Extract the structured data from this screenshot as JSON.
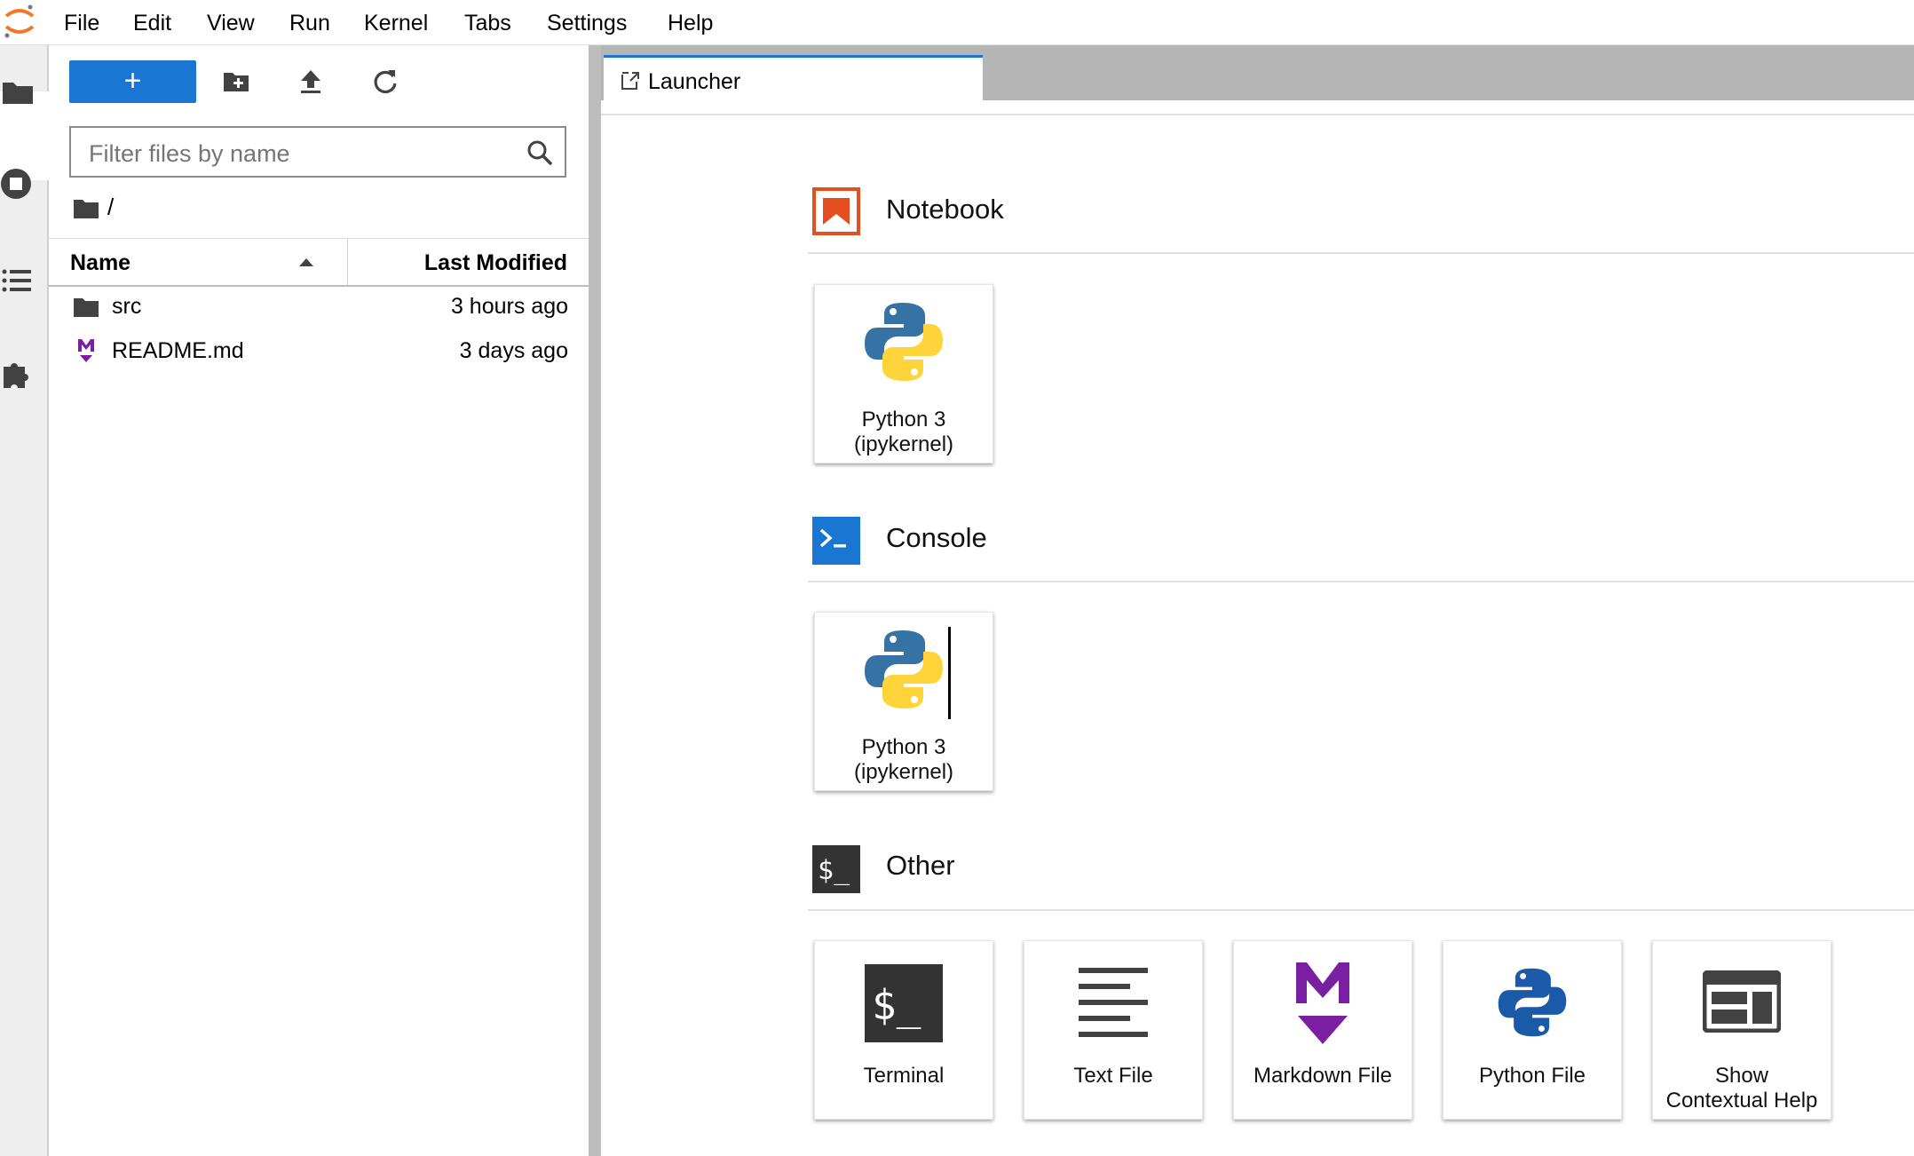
{
  "menu": {
    "items": [
      "File",
      "Edit",
      "View",
      "Run",
      "Kernel",
      "Tabs",
      "Settings",
      "Help"
    ]
  },
  "activity_bar": {
    "icons": [
      "folder-icon",
      "stop-circle-icon",
      "list-icon",
      "puzzle-icon"
    ]
  },
  "file_browser": {
    "new_label": "+",
    "toolbar_icons": [
      "new-folder-icon",
      "upload-icon",
      "refresh-icon"
    ],
    "filter_placeholder": "Filter files by name",
    "breadcrumb": "/",
    "columns": {
      "name": "Name",
      "modified": "Last Modified"
    },
    "files": [
      {
        "name": "src",
        "modified": "3 hours ago",
        "icon": "folder-icon"
      },
      {
        "name": "README.md",
        "modified": "3 days ago",
        "icon": "markdown-icon"
      }
    ]
  },
  "tabs": [
    {
      "label": "Launcher",
      "icon": "launcher-icon"
    }
  ],
  "launcher": {
    "sections": [
      {
        "title": "Notebook",
        "icon": "notebook-icon",
        "color": "#e34f1f",
        "cards": [
          {
            "line1": "Python 3",
            "line2": "(ipykernel)"
          }
        ]
      },
      {
        "title": "Console",
        "icon": "console-icon",
        "color": "#1976d2",
        "cards": [
          {
            "line1": "Python 3",
            "line2": "(ipykernel)"
          }
        ]
      },
      {
        "title": "Other",
        "icon": "terminal-icon",
        "color": "#333333",
        "cards": [
          {
            "line1": "Terminal"
          },
          {
            "line1": "Text File"
          },
          {
            "line1": "Markdown File"
          },
          {
            "line1": "Python File"
          },
          {
            "line1": "Show",
            "line2": "Contextual Help"
          }
        ]
      }
    ]
  },
  "colors": {
    "accent": "#1976d2",
    "markdown": "#7b1fa2",
    "python_blue": "#3772a4",
    "python_yellow": "#ffd43b"
  }
}
